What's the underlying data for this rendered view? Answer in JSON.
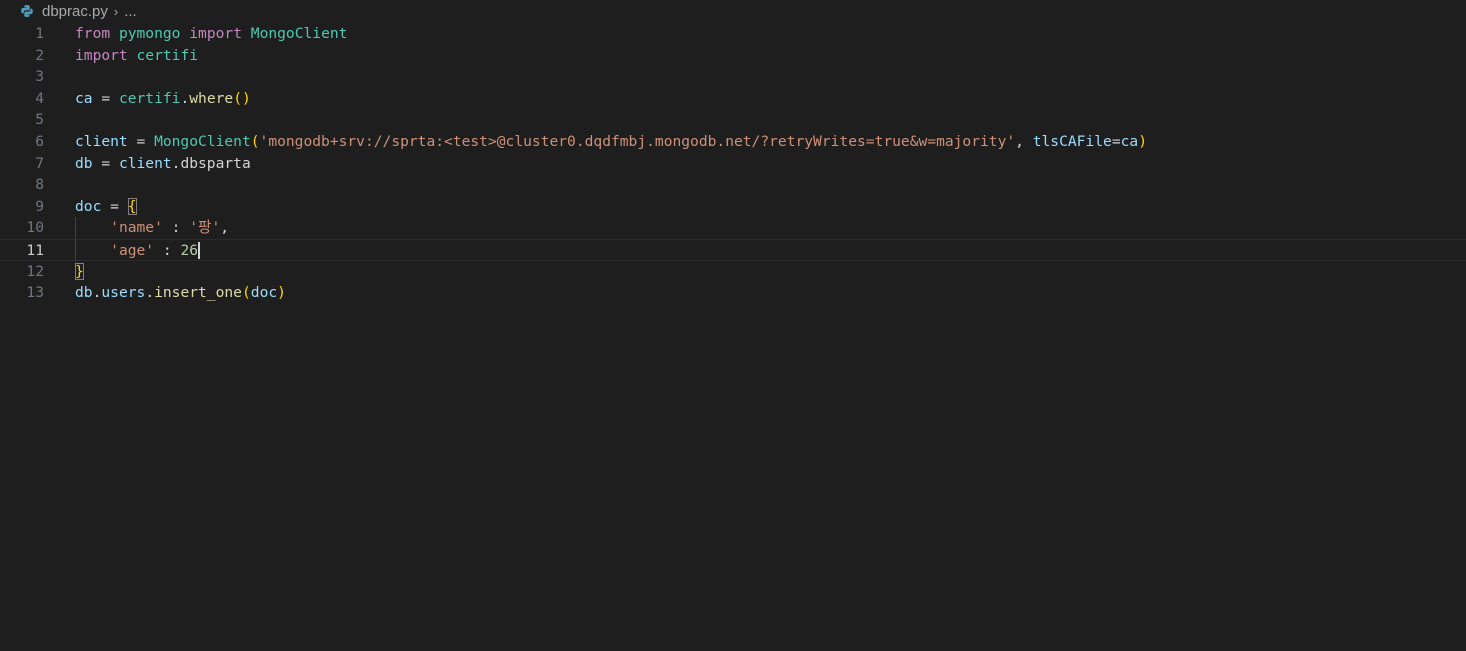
{
  "breadcrumb": {
    "file_icon": "python-icon",
    "file_name": "dbprac.py",
    "separator": "›",
    "more": "..."
  },
  "editor": {
    "current_line": 11,
    "lines": [
      {
        "n": "1",
        "tokens": [
          [
            "kw",
            "from"
          ],
          [
            "plain",
            " "
          ],
          [
            "mod",
            "pymongo"
          ],
          [
            "plain",
            " "
          ],
          [
            "kw",
            "import"
          ],
          [
            "plain",
            " "
          ],
          [
            "cls",
            "MongoClient"
          ]
        ]
      },
      {
        "n": "2",
        "tokens": [
          [
            "kw",
            "import"
          ],
          [
            "plain",
            " "
          ],
          [
            "mod",
            "certifi"
          ]
        ]
      },
      {
        "n": "3",
        "tokens": []
      },
      {
        "n": "4",
        "tokens": [
          [
            "var",
            "ca"
          ],
          [
            "plain",
            " = "
          ],
          [
            "mod",
            "certifi"
          ],
          [
            "plain",
            "."
          ],
          [
            "fn",
            "where"
          ],
          [
            "br1",
            "()"
          ]
        ]
      },
      {
        "n": "5",
        "tokens": []
      },
      {
        "n": "6",
        "tokens": [
          [
            "var",
            "client"
          ],
          [
            "plain",
            " = "
          ],
          [
            "cls",
            "MongoClient"
          ],
          [
            "br1",
            "("
          ],
          [
            "str",
            "'mongodb+srv://sprta:<test>@cluster0.dqdfmbj.mongodb.net/?retryWrites=true&w=majority'"
          ],
          [
            "plain",
            ", "
          ],
          [
            "var",
            "tlsCAFile"
          ],
          [
            "plain",
            "="
          ],
          [
            "var",
            "ca"
          ],
          [
            "br1",
            ")"
          ]
        ]
      },
      {
        "n": "7",
        "tokens": [
          [
            "var",
            "db"
          ],
          [
            "plain",
            " = "
          ],
          [
            "var",
            "client"
          ],
          [
            "plain",
            ".dbsparta"
          ]
        ]
      },
      {
        "n": "8",
        "tokens": []
      },
      {
        "n": "9",
        "tokens": [
          [
            "var",
            "doc"
          ],
          [
            "plain",
            " = "
          ],
          [
            "br1 bracket-match",
            "{"
          ]
        ]
      },
      {
        "n": "10",
        "tokens": [
          [
            "plain",
            "    "
          ],
          [
            "str",
            "'name'"
          ],
          [
            "plain",
            " : "
          ],
          [
            "str",
            "'팡'"
          ],
          [
            "plain",
            ","
          ]
        ]
      },
      {
        "n": "11",
        "tokens": [
          [
            "plain",
            "    "
          ],
          [
            "str",
            "'age'"
          ],
          [
            "plain",
            " : "
          ],
          [
            "num",
            "26"
          ],
          [
            "cursor",
            ""
          ]
        ]
      },
      {
        "n": "12",
        "tokens": [
          [
            "br1 bracket-match",
            "}"
          ]
        ]
      },
      {
        "n": "13",
        "tokens": [
          [
            "var",
            "db"
          ],
          [
            "plain",
            "."
          ],
          [
            "var",
            "users"
          ],
          [
            "plain",
            "."
          ],
          [
            "fn",
            "insert_one"
          ],
          [
            "br1",
            "("
          ],
          [
            "var",
            "doc"
          ],
          [
            "br1",
            ")"
          ]
        ]
      }
    ]
  }
}
